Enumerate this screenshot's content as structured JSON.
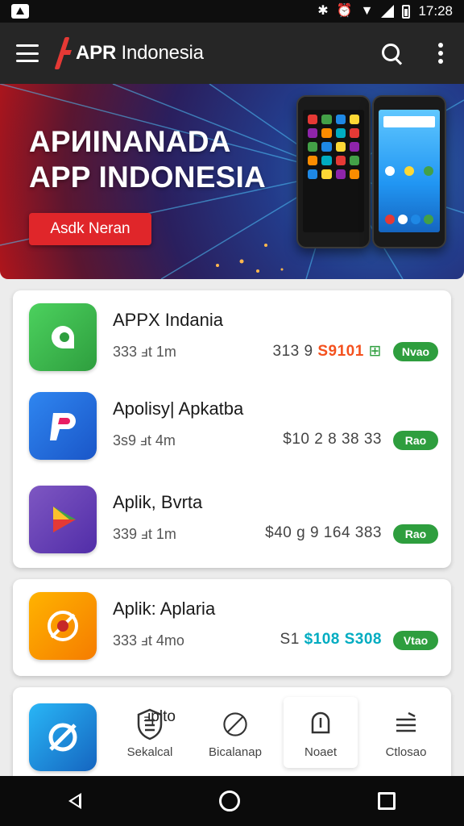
{
  "status_bar": {
    "time": "17:28"
  },
  "app_bar": {
    "title_bold": "APR",
    "title_rest": " Indonesia"
  },
  "banner": {
    "headline_line1": "APИINANADA",
    "headline_line2": "APP INDONESIA",
    "cta_label": "Asdk Neran"
  },
  "featured_apps": [
    {
      "name": "APPX Indania",
      "meta": "333 ⅎt 1m",
      "price_prefix": "313 9 ",
      "price_highlight": "S9101",
      "price_suffix": " ⊞",
      "badge": "Nvao",
      "icon_color": "#3bb54a"
    },
    {
      "name": "Apolisy| Apkatba",
      "meta": "3s9 ⅎt 4m",
      "price_prefix": "$10 2 8 38 33",
      "price_highlight": "",
      "price_suffix": "",
      "badge": "Rao",
      "icon_color": "#1e6fe0"
    },
    {
      "name": "Aplik, Bvrta",
      "meta": "339 ⅎt 1m",
      "price_prefix": "$40 g 9 164 383",
      "price_highlight": "",
      "price_suffix": "",
      "badge": "Rao",
      "icon_color": "#6a3fc2"
    }
  ],
  "second_card_app": {
    "name": "Aplik: Aplaria",
    "meta": "333 ⅎt 4mo",
    "price_prefix": "S1 ",
    "price_highlight": "$108 S308",
    "price_suffix": "",
    "badge": "Vtao",
    "icon_color": "#f2a01e"
  },
  "third_card": {
    "partial_title": "ⅎplto",
    "icon_color": "#1e88e5",
    "nav_items": [
      {
        "label": "Sekalcal",
        "icon": "shield-list-icon"
      },
      {
        "label": "Bicalanap",
        "icon": "compass-icon"
      },
      {
        "label": "Noaet",
        "icon": "alert-icon"
      },
      {
        "label": "Ctlosao",
        "icon": "menu-list-icon"
      }
    ]
  },
  "colors": {
    "accent_green": "#2e9e3e",
    "brand_red": "#e53935",
    "appbar": "#262626"
  }
}
